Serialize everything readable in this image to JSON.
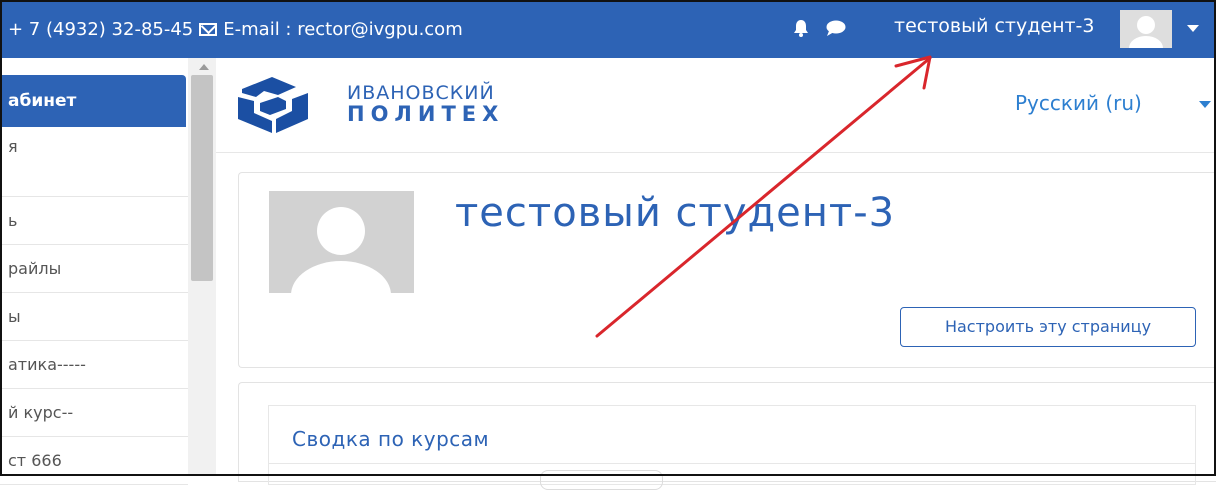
{
  "topbar": {
    "phone": "+ 7 (4932) 32-85-45",
    "email_label": "E-mail : rector@ivgpu.com",
    "username": "тестовый студент-3"
  },
  "sidebar": {
    "header": "абинет",
    "items": [
      {
        "label": "я"
      },
      {
        "label": "ь"
      },
      {
        "label": "райлы"
      },
      {
        "label": "ы"
      },
      {
        "label": "атика-----"
      },
      {
        "label": "й курс--"
      },
      {
        "label": "ст 666"
      }
    ]
  },
  "brand": {
    "line1": "ИВАНОВСКИЙ",
    "line2": "ПОЛИТЕХ",
    "color": "#2d63b5"
  },
  "language": {
    "selected": "Русский (ru)"
  },
  "profile": {
    "name": "тестовый студент-3",
    "customize_button": "Настроить эту страницу"
  },
  "overview": {
    "title": "Сводка по курсам"
  },
  "colors": {
    "accent": "#2d63b5",
    "annotation": "#d9262c"
  },
  "icons": [
    "bell-icon",
    "chat-icon",
    "mail-icon",
    "caret-down-icon"
  ]
}
